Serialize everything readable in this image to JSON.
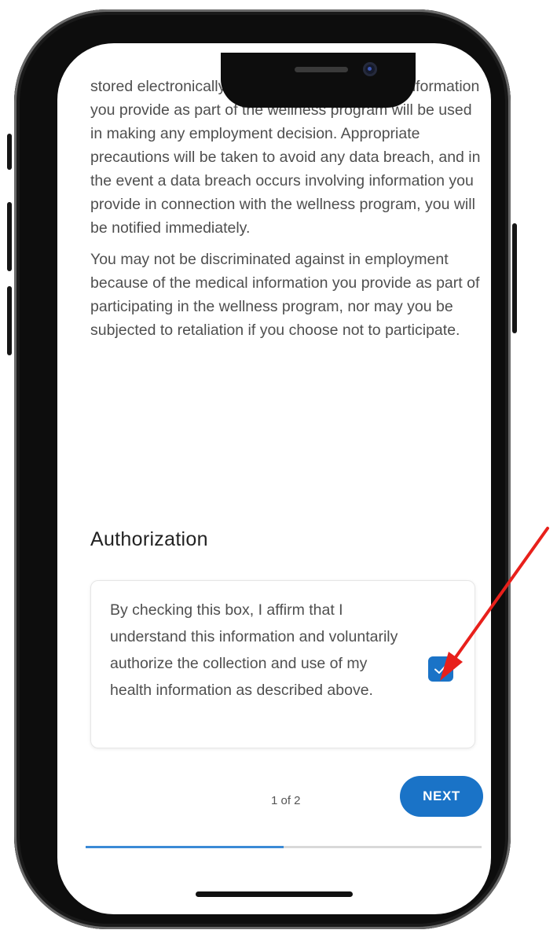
{
  "content": {
    "paragraphs": [
      "stored electronically will be encrypted, and no information you provide as part of the wellness program will be used in making any employment decision. Appropriate precautions will be taken to avoid any data breach, and in the event a data breach occurs involving information you provide in connection with the wellness program, you will be notified immediately.",
      "You may not be discriminated against in employment because of the medical information you provide as part of participating in the wellness program, nor may you be subjected to retaliation if you choose not to participate."
    ],
    "section_title": "Authorization"
  },
  "authorization": {
    "text": "By checking this box, I affirm that I understand this information and voluntarily authorize the collection and use of my health information as described above.",
    "checked": true
  },
  "footer": {
    "page_indicator": "1 of 2",
    "next_label": "NEXT",
    "progress": 0.5
  },
  "colors": {
    "accent": "#1a73c7",
    "progress": "#3b8ad6",
    "annotation_arrow": "#e8201b"
  },
  "icons": {
    "checkbox": "check-icon",
    "annotation": "red-arrow-icon"
  }
}
